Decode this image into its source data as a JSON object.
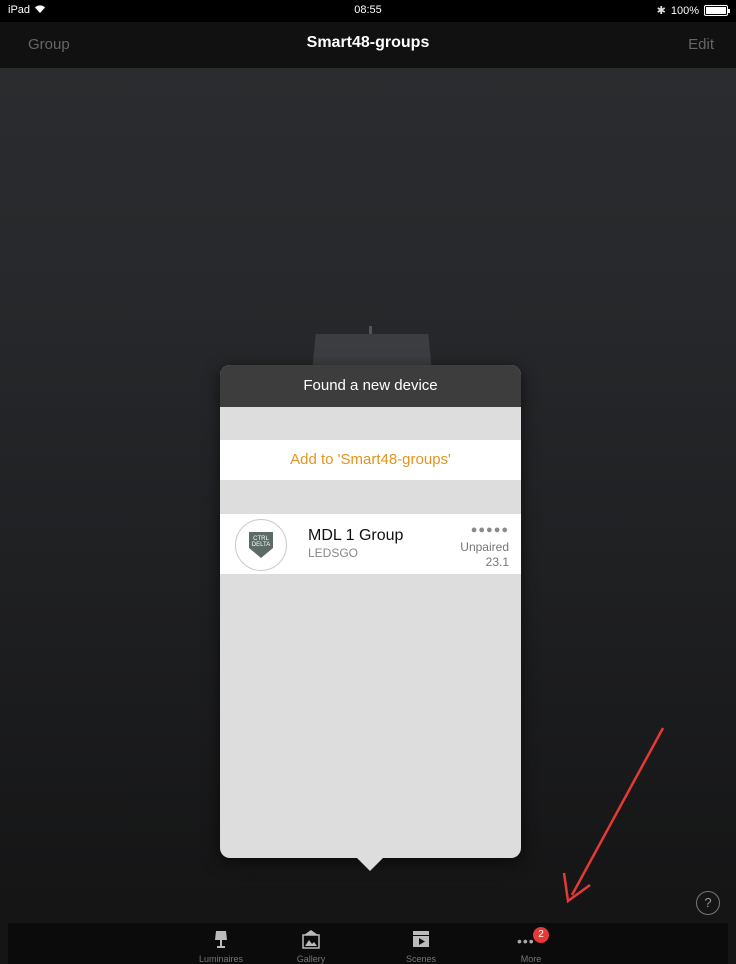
{
  "status_bar": {
    "device": "iPad",
    "time": "08:55",
    "battery": "100%",
    "icons": [
      "wifi-icon",
      "bluetooth-icon",
      "battery-icon"
    ]
  },
  "nav": {
    "left": "Group",
    "title": "Smart48-groups",
    "right": "Edit"
  },
  "popover": {
    "title": "Found a new device",
    "add_label": "Add to 'Smart48-groups'",
    "device": {
      "name": "MDL 1 Group",
      "vendor": "LEDSGO",
      "signal": "●●●●●",
      "status": "Unpaired",
      "version": "23.1",
      "logo_text_1": "CTRL",
      "logo_text_2": "DELTA"
    }
  },
  "help": "?",
  "tabs": [
    {
      "label": "Luminaires",
      "icon": "lamp-icon"
    },
    {
      "label": "Gallery",
      "icon": "gallery-icon"
    },
    {
      "label": "Scenes",
      "icon": "clapperboard-icon"
    },
    {
      "label": "More",
      "icon": "more-icon",
      "badge": "2"
    }
  ],
  "colors": {
    "accent": "#e3941e",
    "badge": "#e53935",
    "annotation_arrow": "#e53935"
  }
}
